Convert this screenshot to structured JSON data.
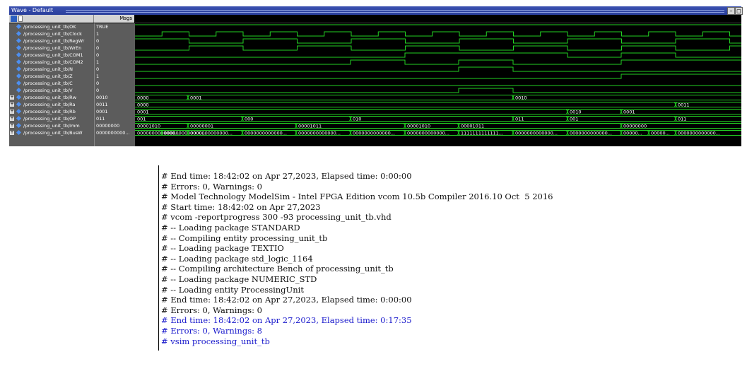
{
  "window": {
    "title": "Wave - Default"
  },
  "header": {
    "msgs_label": "Msgs",
    "minimize": "–",
    "maximize": "◻"
  },
  "colors": {
    "wave_bg": "#000000",
    "signal": "#22d022",
    "grid": "#333333",
    "panel": "#5c5c5c"
  },
  "signals": [
    {
      "name": "/processing_unit_tb/OK",
      "value": "TRUE",
      "expandable": false
    },
    {
      "name": "/processing_unit_tb/Clock",
      "value": "1",
      "expandable": false
    },
    {
      "name": "/processing_unit_tb/RegWr",
      "value": "0",
      "expandable": false
    },
    {
      "name": "/processing_unit_tb/WrEn",
      "value": "0",
      "expandable": false
    },
    {
      "name": "/processing_unit_tb/COM1",
      "value": "0",
      "expandable": false
    },
    {
      "name": "/processing_unit_tb/COM2",
      "value": "1",
      "expandable": false
    },
    {
      "name": "/processing_unit_tb/N",
      "value": "0",
      "expandable": false
    },
    {
      "name": "/processing_unit_tb/Z",
      "value": "1",
      "expandable": false
    },
    {
      "name": "/processing_unit_tb/C",
      "value": "0",
      "expandable": false
    },
    {
      "name": "/processing_unit_tb/V",
      "value": "0",
      "expandable": false
    },
    {
      "name": "/processing_unit_tb/Rw",
      "value": "0010",
      "expandable": true
    },
    {
      "name": "/processing_unit_tb/Ra",
      "value": "0011",
      "expandable": true
    },
    {
      "name": "/processing_unit_tb/Rb",
      "value": "0001",
      "expandable": true
    },
    {
      "name": "/processing_unit_tb/OP",
      "value": "011",
      "expandable": true
    },
    {
      "name": "/processing_unit_tb/Imm",
      "value": "00000000",
      "expandable": true
    },
    {
      "name": "/processing_unit_tb/BusW",
      "value": "0000000000...",
      "expandable": true
    }
  ],
  "bus_labels": {
    "Rw": [
      [
        "0000",
        0
      ],
      [
        "0001",
        75
      ],
      [
        "0010",
        535
      ]
    ],
    "Ra": [
      [
        "0000",
        0
      ],
      [
        "0011",
        765
      ]
    ],
    "Rb": [
      [
        "0001",
        0
      ],
      [
        "0010",
        612
      ],
      [
        "0001",
        688
      ]
    ],
    "OP": [
      [
        "001",
        0
      ],
      [
        "000",
        152
      ],
      [
        "010",
        305
      ],
      [
        "011",
        535
      ],
      [
        "001",
        612
      ],
      [
        "011",
        765
      ]
    ],
    "Imm": [
      [
        "00001010",
        0
      ],
      [
        "00000001",
        75
      ],
      [
        "00001011",
        228
      ],
      [
        "00001010",
        382
      ],
      [
        "00001011",
        458
      ],
      [
        "00000000",
        688
      ]
    ],
    "BusW": [
      [
        "0000000000000...",
        0
      ],
      [
        "0000000000000...",
        38
      ],
      [
        "0000000000000...",
        75
      ],
      [
        "0000000000000...",
        152
      ],
      [
        "0000000000000...",
        228
      ],
      [
        "0000000000000...",
        305
      ],
      [
        "0000000000000...",
        382
      ],
      [
        "1111111111111...",
        458
      ],
      [
        "0000000000000...",
        535
      ],
      [
        "0000000000000...",
        612
      ],
      [
        "00000...",
        688
      ],
      [
        "00000...",
        727
      ],
      [
        "0000000000000...",
        765
      ]
    ]
  },
  "console": {
    "lines": [
      {
        "text": "# End time: 18:42:02 on Apr 27,2023, Elapsed time: 0:00:00",
        "highlight": false
      },
      {
        "text": "# Errors: 0, Warnings: 0",
        "highlight": false
      },
      {
        "text": "# Model Technology ModelSim - Intel FPGA Edition vcom 10.5b Compiler 2016.10 Oct  5 2016",
        "highlight": false
      },
      {
        "text": "# Start time: 18:42:02 on Apr 27,2023",
        "highlight": false
      },
      {
        "text": "# vcom -reportprogress 300 -93 processing_unit_tb.vhd",
        "highlight": false
      },
      {
        "text": "# -- Loading package STANDARD",
        "highlight": false
      },
      {
        "text": "# -- Compiling entity processing_unit_tb",
        "highlight": false
      },
      {
        "text": "# -- Loading package TEXTIO",
        "highlight": false
      },
      {
        "text": "# -- Loading package std_logic_1164",
        "highlight": false
      },
      {
        "text": "# -- Compiling architecture Bench of processing_unit_tb",
        "highlight": false
      },
      {
        "text": "# -- Loading package NUMERIC_STD",
        "highlight": false
      },
      {
        "text": "# -- Loading entity ProcessingUnit",
        "highlight": false
      },
      {
        "text": "# End time: 18:42:02 on Apr 27,2023, Elapsed time: 0:00:00",
        "highlight": false
      },
      {
        "text": "# Errors: 0, Warnings: 0",
        "highlight": false
      },
      {
        "text": "# End time: 18:42:02 on Apr 27,2023, Elapsed time: 0:17:35",
        "highlight": true
      },
      {
        "text": "# Errors: 0, Warnings: 8",
        "highlight": true
      },
      {
        "text": "# vsim processing_unit_tb",
        "highlight": true
      }
    ]
  }
}
